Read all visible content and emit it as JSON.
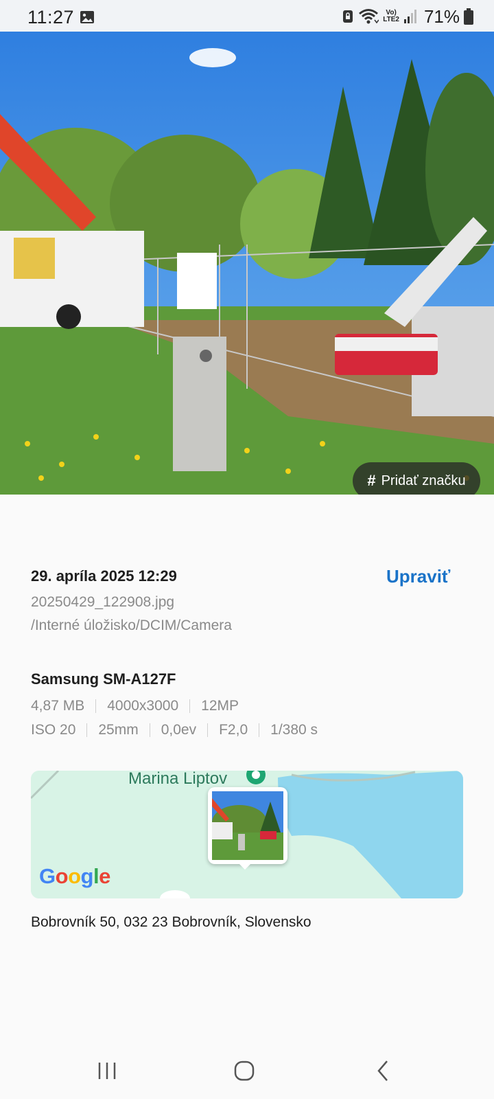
{
  "status_bar": {
    "time": "11:27",
    "battery": "71%",
    "network": "LTE2",
    "volte": "Vo)",
    "icons": [
      "gallery-icon",
      "vpn-lock-icon",
      "wifi-icon",
      "volte-icon",
      "signal-icon",
      "battery-icon"
    ]
  },
  "photo": {
    "tag_button_label": "Pridať značku",
    "tag_button_icon": "#"
  },
  "details": {
    "date_time": "29. apríla 2025 12:29",
    "edit_label": "Upraviť",
    "filename": "20250429_122908.jpg",
    "path": "/Interné úložisko/DCIM/Camera",
    "device": "Samsung SM-A127F",
    "meta_row_1": [
      "4,87 MB",
      "4000x3000",
      "12MP"
    ],
    "meta_row_2": [
      "ISO 20",
      "25mm",
      "0,0ev",
      "F2,0",
      "1/380 s"
    ]
  },
  "map": {
    "poi_label": "Marina Liptov",
    "provider": "Google",
    "provider_letters": [
      "G",
      "o",
      "o",
      "g",
      "l",
      "e"
    ]
  },
  "address": "Bobrovník 50, 032 23 Bobrovník, Slovensko",
  "colors": {
    "accent": "#1a73c8",
    "status_bar_bg": "#f1f3f6",
    "page_bg": "#fafafa",
    "map_land": "#d8f3e6",
    "map_water": "#8fd6ee"
  },
  "nav_bar": {
    "icons": [
      "recent-apps-icon",
      "home-icon",
      "back-icon"
    ]
  }
}
